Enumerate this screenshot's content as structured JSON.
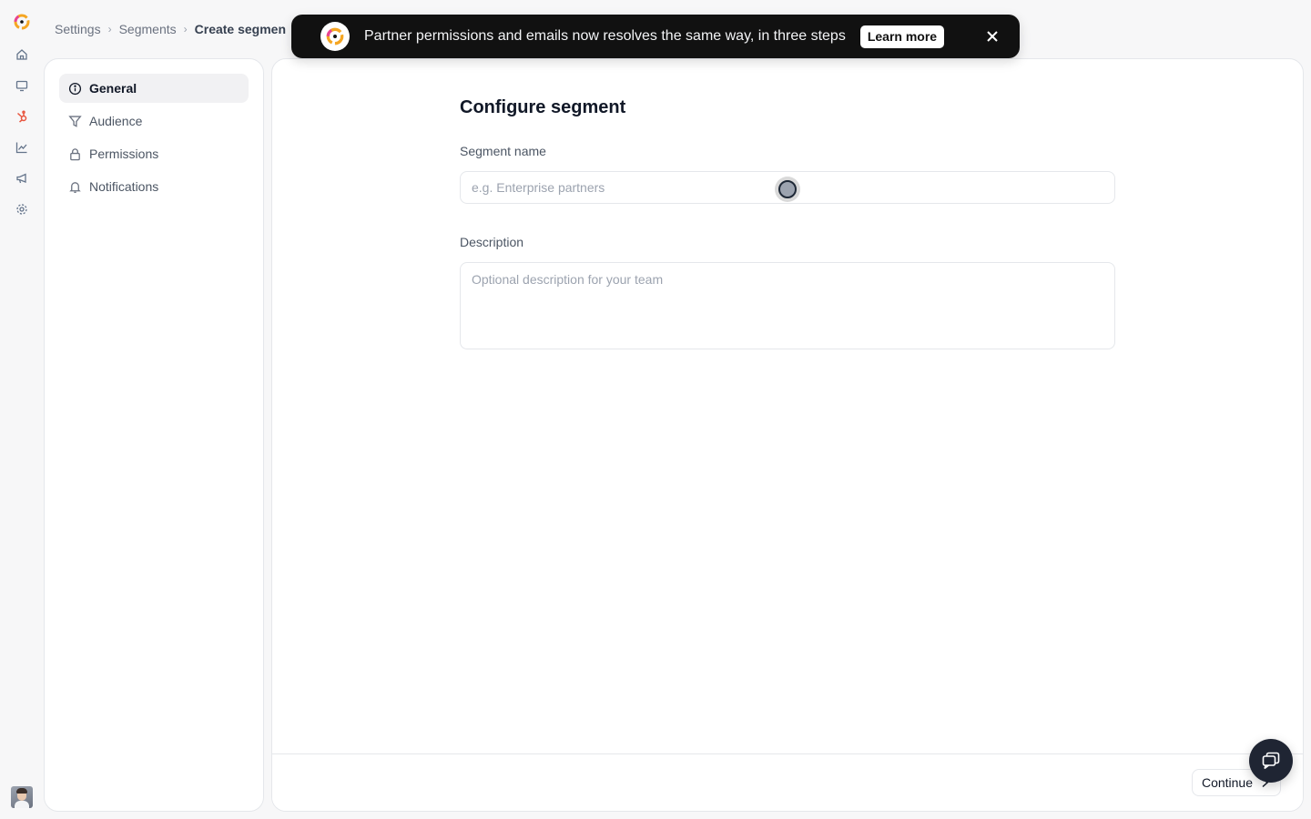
{
  "breadcrumb": {
    "items": [
      "Settings",
      "Segments"
    ],
    "current": "Create segmen"
  },
  "rail": {
    "icons": [
      "home-icon",
      "monitor-icon",
      "hubspot-icon",
      "chart-icon",
      "megaphone-icon",
      "gear-icon"
    ],
    "active": "hubspot-icon"
  },
  "sidebar": {
    "items": [
      {
        "label": "General",
        "icon": "info-icon",
        "active": true
      },
      {
        "label": "Audience",
        "icon": "filter-icon",
        "active": false
      },
      {
        "label": "Permissions",
        "icon": "lock-icon",
        "active": false
      },
      {
        "label": "Notifications",
        "icon": "bell-icon",
        "active": false
      }
    ]
  },
  "form": {
    "title": "Configure segment",
    "name_label": "Segment name",
    "name_placeholder": "e.g. Enterprise partners",
    "name_value": "",
    "description_label": "Description",
    "description_placeholder": "Optional description for your team",
    "description_value": ""
  },
  "footer": {
    "continue_label": "Continue"
  },
  "banner": {
    "text": "Partner permissions and emails now resolves the same way, in three steps",
    "button_label": "Learn more"
  },
  "colors": {
    "accent": "#e8553e",
    "banner_bg": "#111111",
    "chat_fab": "#1f2533"
  }
}
